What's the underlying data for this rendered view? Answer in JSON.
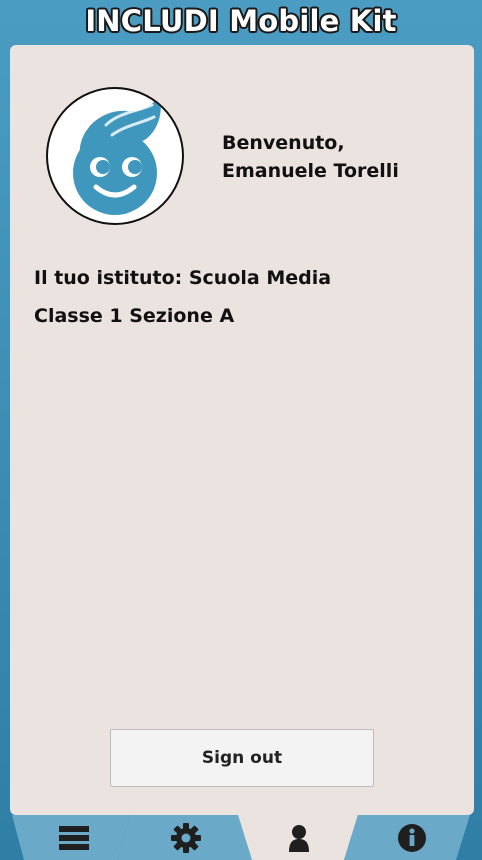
{
  "app": {
    "title": "INCLUDI Mobile Kit"
  },
  "profile": {
    "greeting_line1": "Benvenuto,",
    "greeting_line2": "Emanuele Torelli",
    "school": "Il tuo istituto: Scuola Media",
    "class": "Classe 1 Sezione A",
    "avatar_icon": "child-face-icon"
  },
  "actions": {
    "sign_out_label": "Sign out"
  },
  "tabs": [
    {
      "icon": "menu-icon",
      "active": false
    },
    {
      "icon": "gear-icon",
      "active": false
    },
    {
      "icon": "user-icon",
      "active": true
    },
    {
      "icon": "info-icon",
      "active": false
    }
  ],
  "colors": {
    "frame": "#3f8fb5",
    "panel": "#ebe3df",
    "tab_inactive": "#6aa9c8",
    "tab_active": "#ebe3df",
    "icon": "#1f1f1f",
    "avatar_blue": "#3f97bd"
  }
}
